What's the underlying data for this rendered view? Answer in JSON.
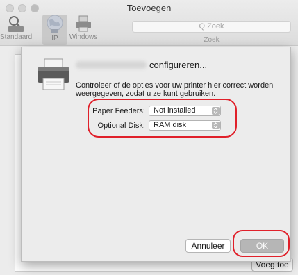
{
  "window": {
    "title": "Toevoegen",
    "toolbar": [
      {
        "label": "Standaard",
        "icon": "printer-search-icon"
      },
      {
        "label": "IP",
        "icon": "globe-icon",
        "selected": true
      },
      {
        "label": "Windows",
        "icon": "printer-icon"
      }
    ],
    "search": {
      "placeholder": "Q Zoek",
      "caption": "Zoek"
    },
    "add_button": "Voeg toe"
  },
  "sheet": {
    "title": "configureren...",
    "description": "Controleer of de opties voor uw printer hier correct worden weergegeven, zodat u ze kunt gebruiken.",
    "options": [
      {
        "label": "Paper Feeders:",
        "value": "Not installed"
      },
      {
        "label": "Optional Disk:",
        "value": "RAM disk"
      }
    ],
    "cancel_label": "Annuleer",
    "ok_label": "OK"
  },
  "annotations": {
    "color": "#e0202a"
  }
}
